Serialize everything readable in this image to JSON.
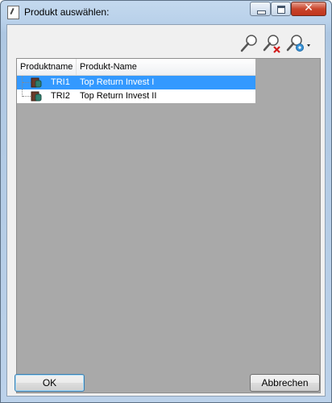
{
  "window": {
    "title": "Produkt auswählen:",
    "close_glyph": "✕"
  },
  "toolbar": {
    "icons": [
      "search-icon",
      "clear-search-icon",
      "search-settings-icon"
    ]
  },
  "table": {
    "columns": [
      "Produktname",
      "Produkt-Name"
    ],
    "rows": [
      {
        "code": "TRI1",
        "name": "Top Return Invest I",
        "selected": true
      },
      {
        "code": "TRI2",
        "name": "Top Return Invest II",
        "selected": false
      }
    ]
  },
  "buttons": {
    "ok": "OK",
    "cancel": "Abbrechen"
  },
  "colors": {
    "selection": "#3399ff",
    "grid_background": "#a9a9a9"
  }
}
